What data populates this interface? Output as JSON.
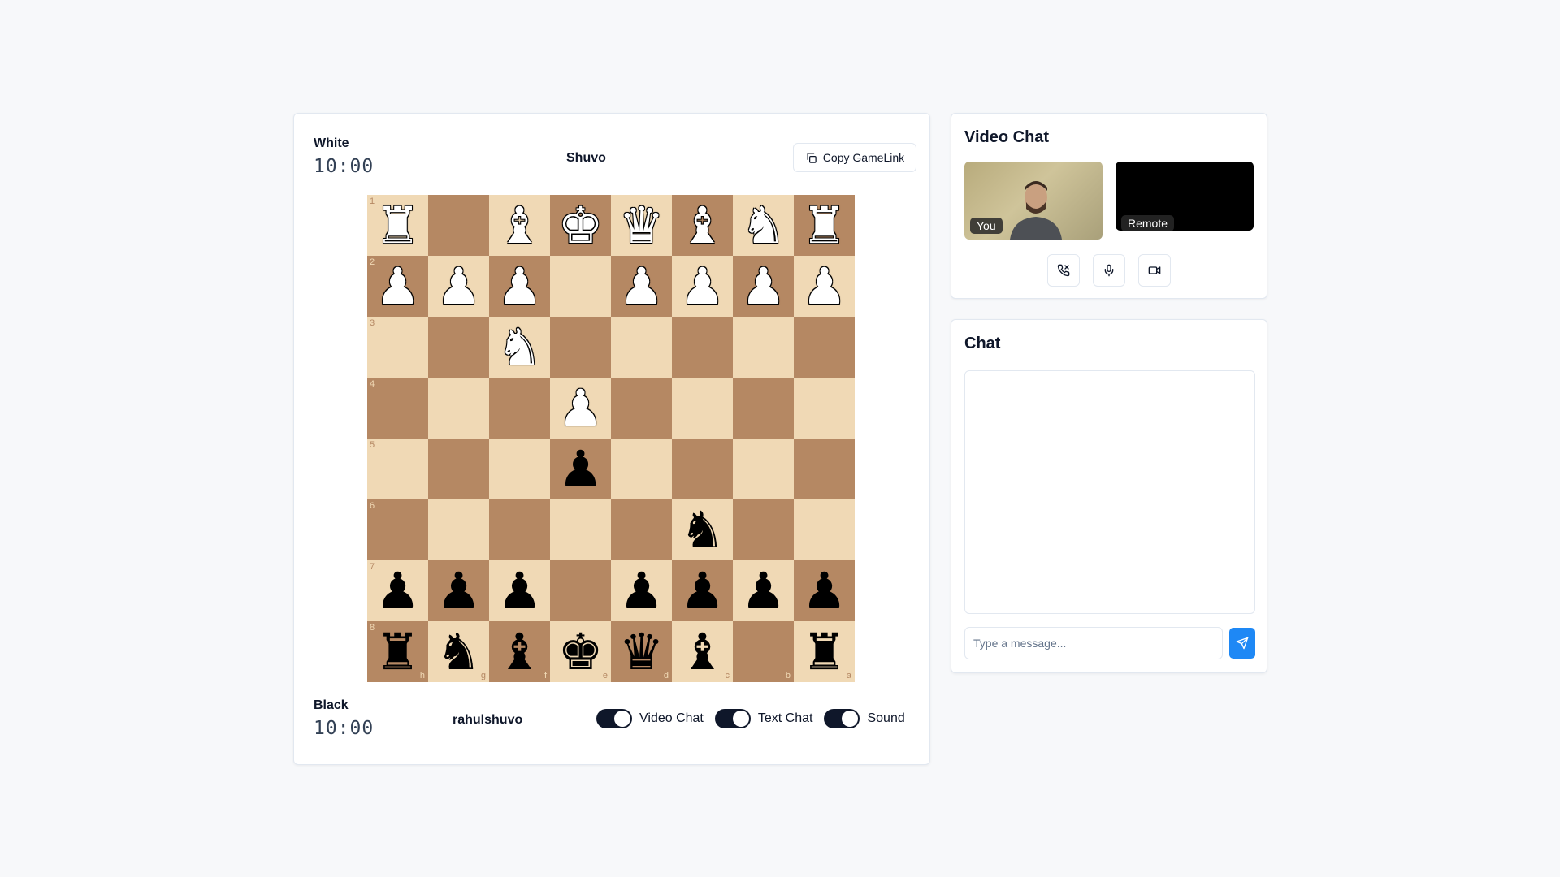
{
  "game": {
    "white": {
      "label": "White",
      "clock": "10:00",
      "name": "Shuvo"
    },
    "black": {
      "label": "Black",
      "clock": "10:00",
      "name": "rahulshuvo"
    },
    "copy_link_label": "Copy GameLink",
    "board": {
      "light_color": "#f0d9b5",
      "dark_color": "#b58863",
      "rank_labels": [
        "1",
        "2",
        "3",
        "4",
        "5",
        "6",
        "7",
        "8"
      ],
      "file_labels": [
        "h",
        "g",
        "f",
        "e",
        "d",
        "c",
        "b",
        "a"
      ],
      "rows": [
        [
          "wR",
          "",
          "wB",
          "wK",
          "wQ",
          "wB",
          "wN",
          "wR"
        ],
        [
          "wP",
          "wP",
          "wP",
          "",
          "wP",
          "wP",
          "wP",
          "wP"
        ],
        [
          "",
          "",
          "wN",
          "",
          "",
          "",
          "",
          ""
        ],
        [
          "",
          "",
          "",
          "wP",
          "",
          "",
          "",
          ""
        ],
        [
          "",
          "",
          "",
          "bP",
          "",
          "",
          "",
          ""
        ],
        [
          "",
          "",
          "",
          "",
          "",
          "bN",
          "",
          ""
        ],
        [
          "bP",
          "bP",
          "bP",
          "",
          "bP",
          "bP",
          "bP",
          "bP"
        ],
        [
          "bR",
          "bN",
          "bB",
          "bK",
          "bQ",
          "bB",
          "",
          "bR"
        ]
      ]
    },
    "toggles": [
      {
        "label": "Video Chat",
        "on": true
      },
      {
        "label": "Text Chat",
        "on": true
      },
      {
        "label": "Sound",
        "on": true
      }
    ]
  },
  "video_chat": {
    "title": "Video Chat",
    "local_label": "You",
    "remote_label": "Remote",
    "controls": [
      "phone-off-icon",
      "microphone-icon",
      "camera-icon"
    ]
  },
  "chat": {
    "title": "Chat",
    "placeholder": "Type a message...",
    "send_color": "#1e88f5"
  }
}
